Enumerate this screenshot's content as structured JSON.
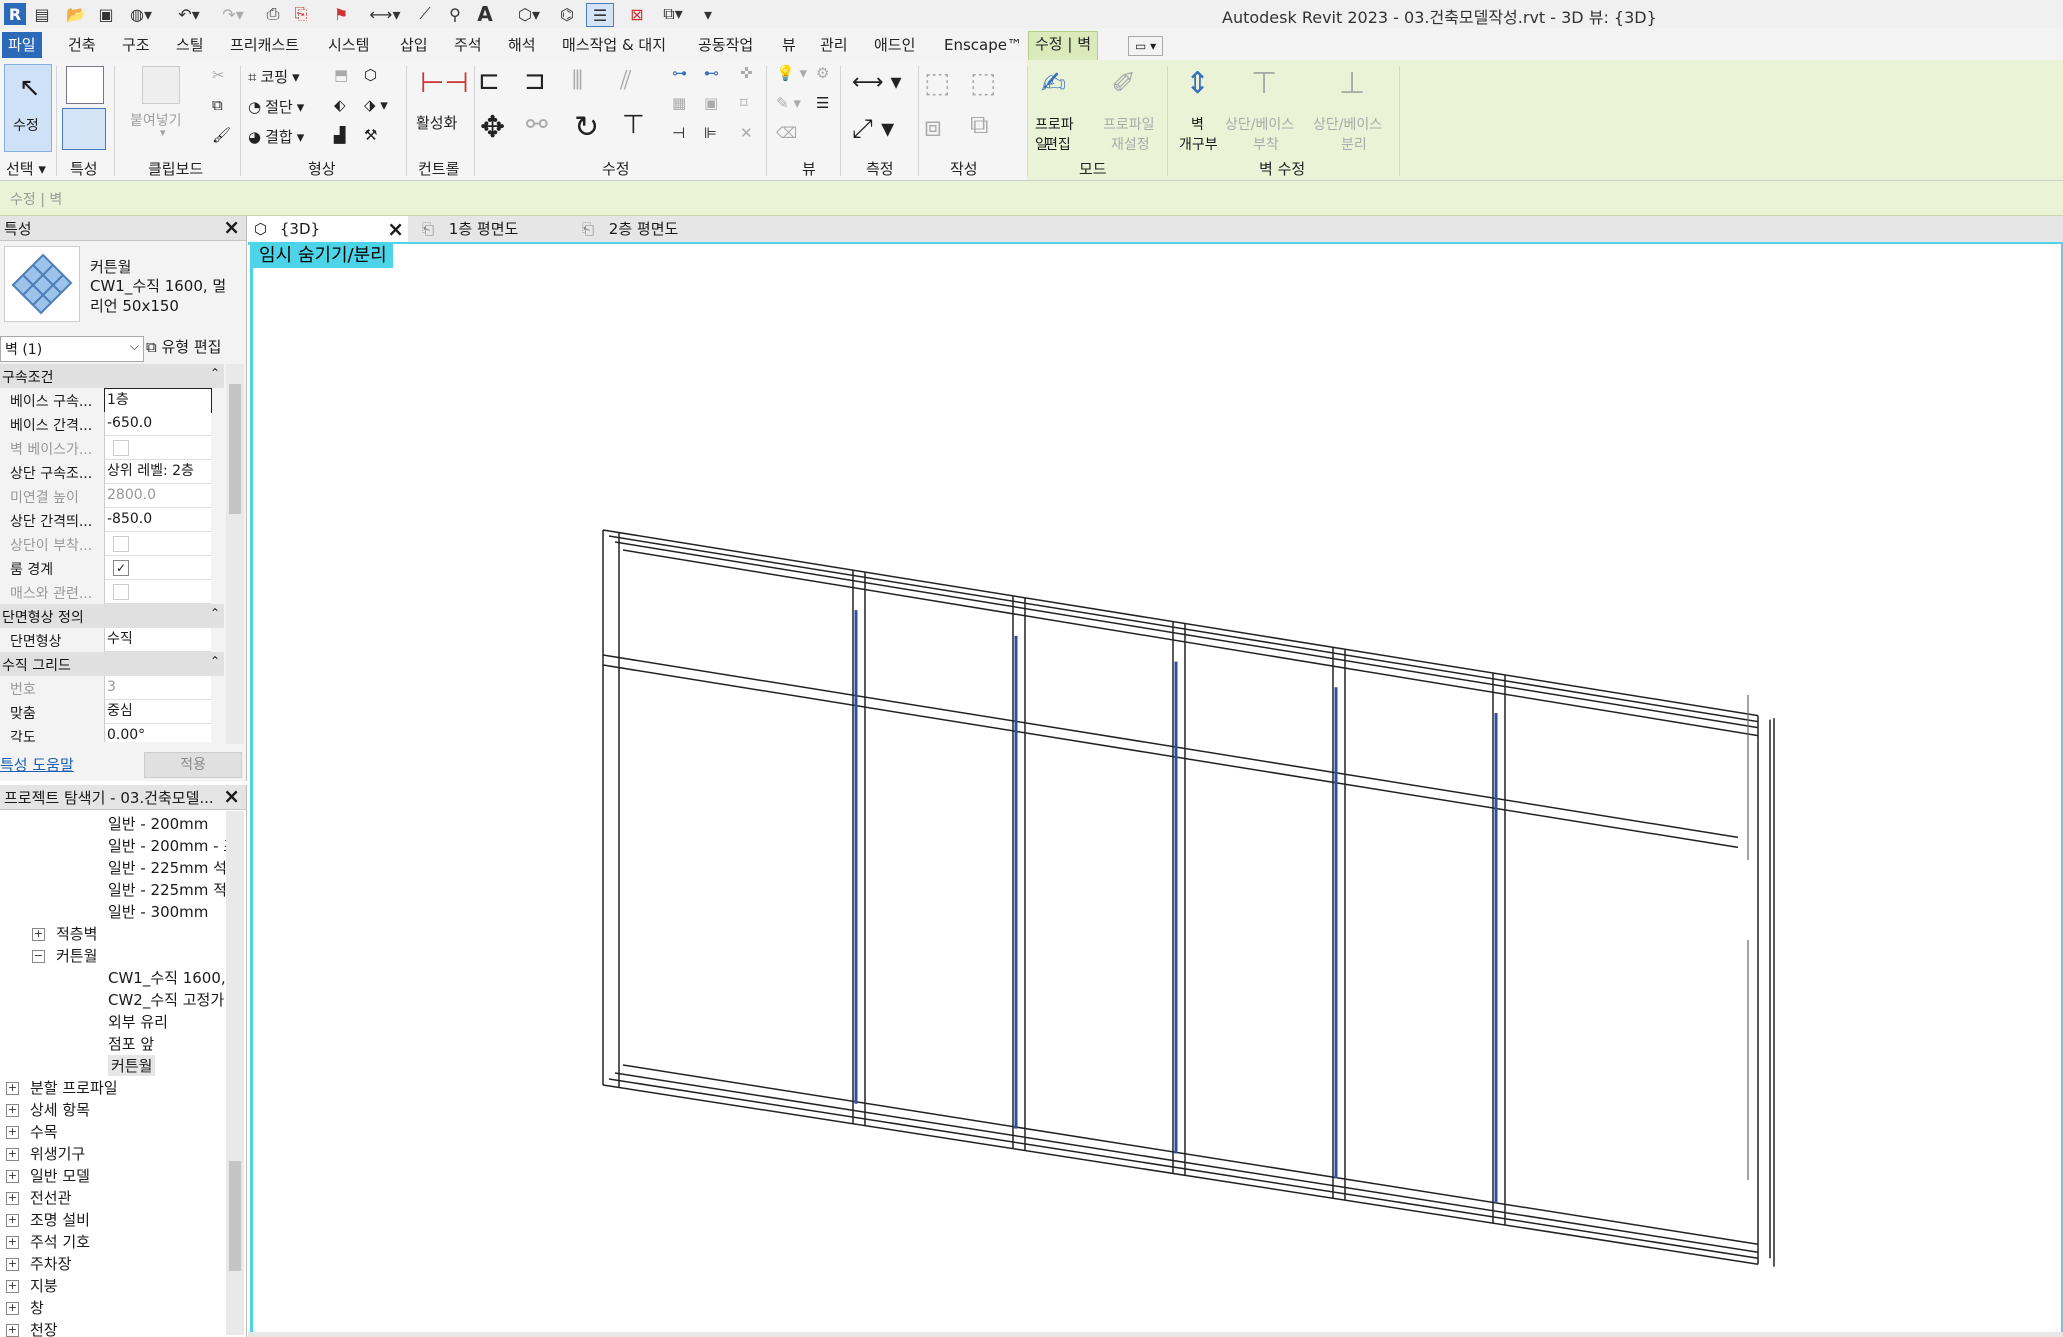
{
  "app": {
    "title": "Autodesk Revit 2023 - 03.건축모델작성.rvt - 3D 뷰: {3D}"
  },
  "ribbon": {
    "tabs": [
      "파일",
      "건축",
      "구조",
      "스틸",
      "프리캐스트",
      "시스템",
      "삽입",
      "주석",
      "해석",
      "매스작업 & 대지",
      "공동작업",
      "뷰",
      "관리",
      "애드인",
      "Enscape™",
      "수정 | 벽"
    ],
    "groups": [
      "선택",
      "특성",
      "클립보드",
      "형상",
      "컨트롤",
      "수정",
      "뷰",
      "측정",
      "작성",
      "모드",
      "벽 수정"
    ],
    "modify": "수정",
    "paste": "붙여넣기",
    "cope": "코핑",
    "cut": "절단",
    "join": "결합",
    "activate": "활성화",
    "edit_profile": [
      "프로파일",
      "편집"
    ],
    "reset_profile": [
      "프로파일",
      "재설정"
    ],
    "wall_opening": [
      "벽",
      "개구부"
    ],
    "attach_top_base": [
      "상단/베이스",
      "부착"
    ],
    "detach_top_base": [
      "상단/베이스",
      "분리"
    ]
  },
  "options_bar": {
    "context": "수정 | 벽"
  },
  "properties": {
    "title": "특성",
    "family": "커튼월",
    "type": "CW1_수직 1600, 멀리언 50x150",
    "selector": "벽 (1)",
    "edit_type": "유형 편집",
    "help": "특성 도움말",
    "apply": "적용",
    "rows": [
      {
        "kind": "sec",
        "label": "구속조건"
      },
      {
        "label": "베이스 구속...",
        "value": "1층",
        "edit": true
      },
      {
        "label": "베이스 간격...",
        "value": "-650.0"
      },
      {
        "label": "벽 베이스가...",
        "check": false,
        "dis": true
      },
      {
        "label": "상단 구속조...",
        "value": "상위 레벨: 2층"
      },
      {
        "label": "미연결 높이",
        "value": "2800.0",
        "dis": true
      },
      {
        "label": "상단 간격띄...",
        "value": "-850.0"
      },
      {
        "label": "상단이 부착...",
        "check": false,
        "dis": true
      },
      {
        "label": "룸 경계",
        "check": true
      },
      {
        "label": "매스와 관련...",
        "check": false,
        "dis": true
      },
      {
        "kind": "sec",
        "label": "단면형상 정의"
      },
      {
        "label": "단면형상",
        "value": "수직"
      },
      {
        "kind": "sec",
        "label": "수직 그리드"
      },
      {
        "label": "번호",
        "value": "3",
        "dis": true
      },
      {
        "label": "맞춤",
        "value": "중심"
      },
      {
        "label": "각도",
        "value": "0.00°"
      }
    ]
  },
  "browser": {
    "title": "프로젝트 탐색기 - 03.건축모델...",
    "nodes": [
      {
        "label": "일반 - 200mm",
        "indent": 3
      },
      {
        "label": "일반 - 200mm - 조",
        "indent": 3
      },
      {
        "label": "일반 - 225mm 석",
        "indent": 3
      },
      {
        "label": "일반 - 225mm 적",
        "indent": 3
      },
      {
        "label": "일반 - 300mm",
        "indent": 3
      },
      {
        "label": "적층벽",
        "indent": 2,
        "exp": "+"
      },
      {
        "label": "커튼월",
        "indent": 2,
        "exp": "-"
      },
      {
        "label": "CW1_수직 1600,",
        "indent": 3
      },
      {
        "label": "CW2_수직 고정가",
        "indent": 3
      },
      {
        "label": "외부 유리",
        "indent": 3
      },
      {
        "label": "점포 앞",
        "indent": 3
      },
      {
        "label": "커튼월",
        "indent": 3,
        "sel": true
      },
      {
        "label": "분할 프로파일",
        "indent": 1,
        "exp": "+"
      },
      {
        "label": "상세 항목",
        "indent": 1,
        "exp": "+"
      },
      {
        "label": "수목",
        "indent": 1,
        "exp": "+"
      },
      {
        "label": "위생기구",
        "indent": 1,
        "exp": "+"
      },
      {
        "label": "일반 모델",
        "indent": 1,
        "exp": "+"
      },
      {
        "label": "전선관",
        "indent": 1,
        "exp": "+"
      },
      {
        "label": "조명 설비",
        "indent": 1,
        "exp": "+"
      },
      {
        "label": "주석 기호",
        "indent": 1,
        "exp": "+"
      },
      {
        "label": "주차장",
        "indent": 1,
        "exp": "+"
      },
      {
        "label": "지붕",
        "indent": 1,
        "exp": "+"
      },
      {
        "label": "창",
        "indent": 1,
        "exp": "+"
      },
      {
        "label": "천장",
        "indent": 1,
        "exp": "+"
      }
    ]
  },
  "views": {
    "tabs": [
      "{3D}",
      "1층 평면도",
      "2층 평면도"
    ],
    "temp_hide": "임시 숨기기/분리"
  }
}
